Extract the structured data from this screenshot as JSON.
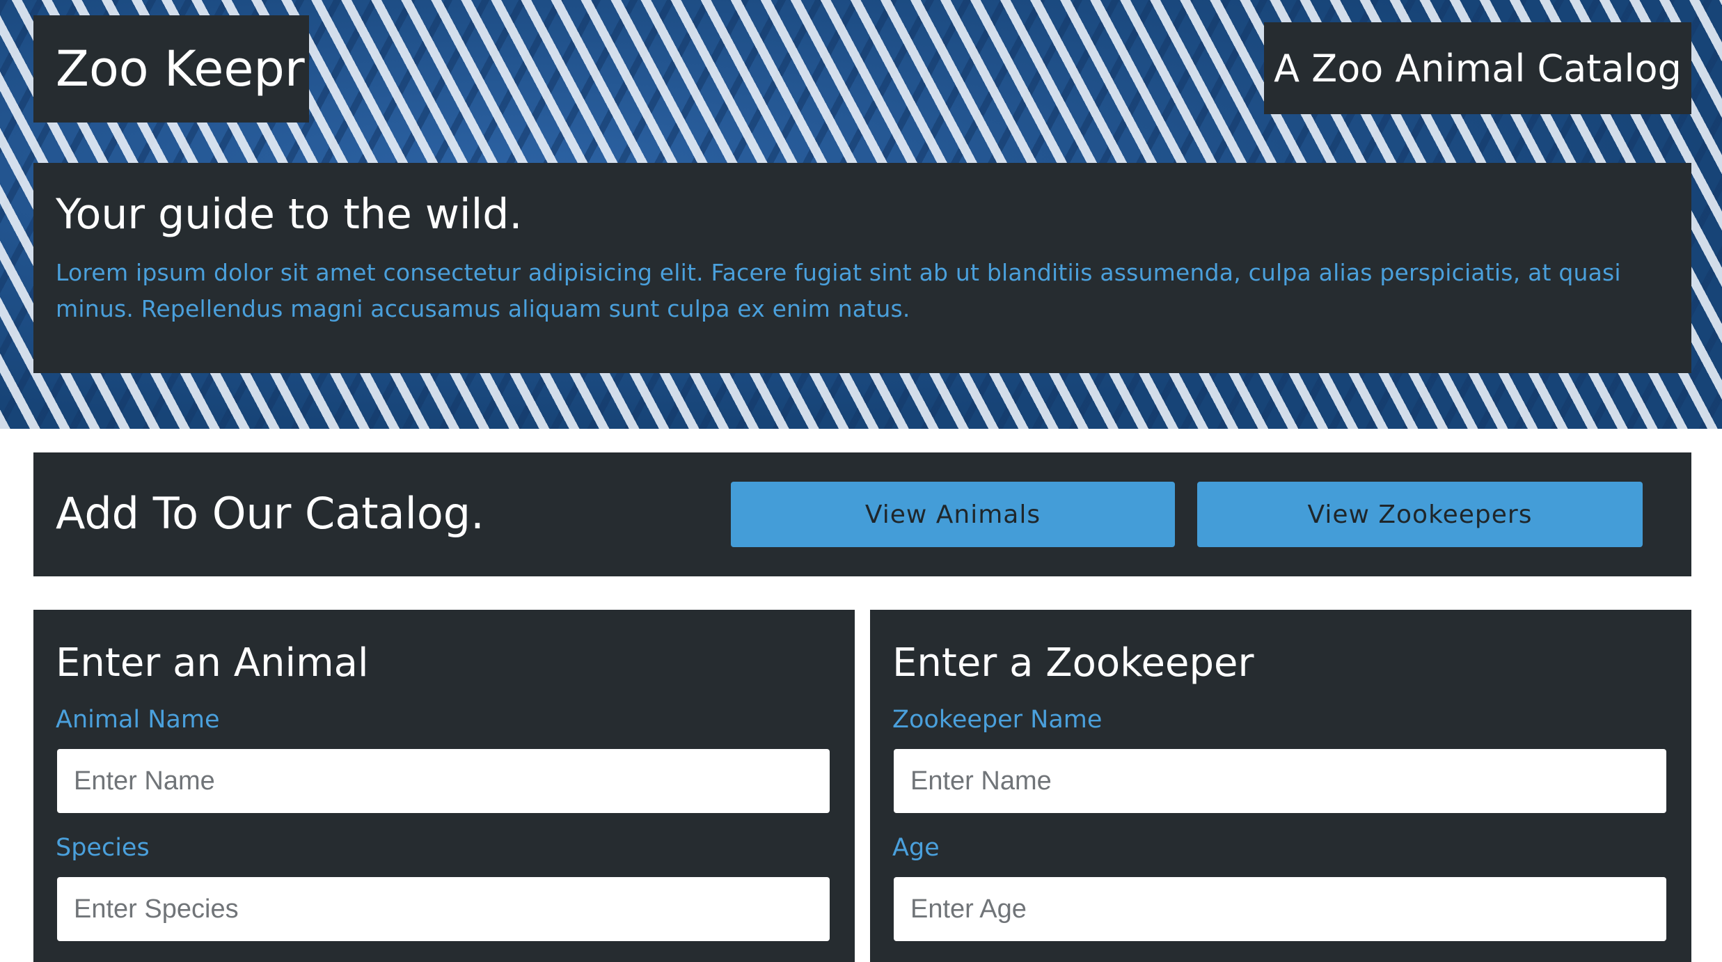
{
  "header": {
    "brand": "Zoo Keepr",
    "tagline": "A Zoo Animal Catalog"
  },
  "intro": {
    "heading": "Your guide to the wild.",
    "body": "Lorem ipsum dolor sit amet consectetur adipisicing elit. Facere fugiat sint ab ut blanditiis assumenda, culpa alias perspiciatis, at quasi minus. Repellendus magni accusamus aliquam sunt culpa ex enim natus."
  },
  "catalog": {
    "title": "Add To Our Catalog.",
    "view_animals_label": "View Animals",
    "view_zookeepers_label": "View Zookeepers"
  },
  "animal_form": {
    "title": "Enter an Animal",
    "name_label": "Animal Name",
    "name_placeholder": "Enter Name",
    "name_value": "",
    "species_label": "Species",
    "species_placeholder": "Enter Species",
    "species_value": ""
  },
  "zookeeper_form": {
    "title": "Enter a Zookeeper",
    "name_label": "Zookeeper Name",
    "name_placeholder": "Enter Name",
    "name_value": "",
    "age_label": "Age",
    "age_placeholder": "Enter Age",
    "age_value": ""
  },
  "colors": {
    "panel": "#262c30",
    "accent": "#4aa0dc",
    "button": "#449dd8"
  }
}
